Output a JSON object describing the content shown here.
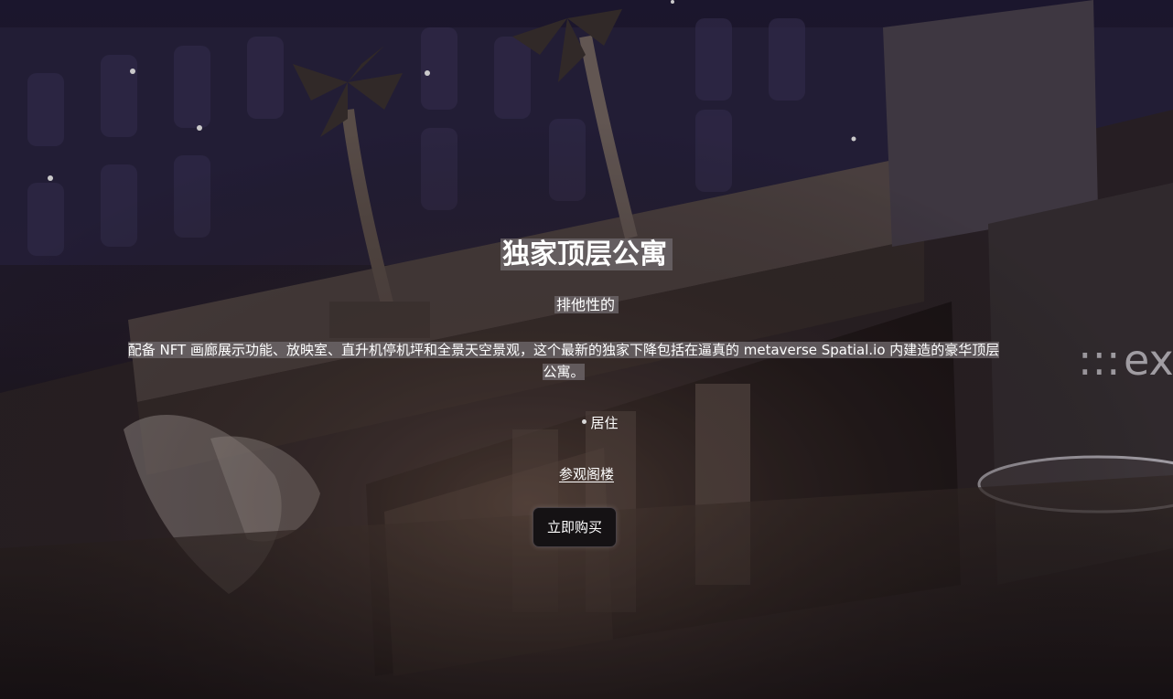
{
  "hero": {
    "title": "独家顶层公寓",
    "subtitle": "排他性的",
    "description": "配备 NFT 画廊展示功能、放映室、直升机停机坪和全景天空景观，这个最新的独家下降包括在逼真的 metaverse Spatial.io 内建造的豪华顶层公寓。",
    "bullets": [
      "居住"
    ],
    "tour_link": "参观阁楼",
    "buy_button": "立即购买",
    "sign_text": "ex"
  },
  "colors": {
    "text": "#ffffff",
    "highlight": "#6e686c",
    "button_bg": "#151214",
    "sky": "#201b33"
  }
}
